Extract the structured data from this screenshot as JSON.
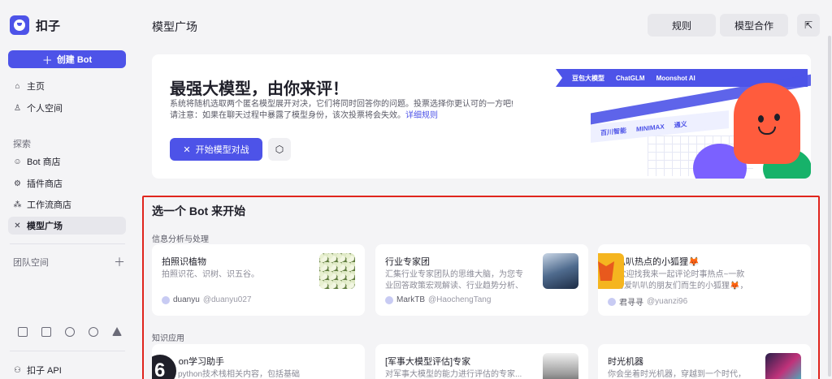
{
  "app": {
    "name": "扣子"
  },
  "sidebar": {
    "create_label": "创建 Bot",
    "nav": [
      {
        "label": "主页",
        "icon": "home-icon"
      },
      {
        "label": "个人空间",
        "icon": "user-icon"
      }
    ],
    "explore_label": "探索",
    "explore": [
      {
        "label": "Bot 商店",
        "icon": "bot-icon"
      },
      {
        "label": "插件商店",
        "icon": "plugin-icon"
      },
      {
        "label": "工作流商店",
        "icon": "workflow-icon"
      },
      {
        "label": "模型广场",
        "icon": "model-icon",
        "active": true
      }
    ],
    "team_label": "团队空间",
    "api_label": "扣子 API"
  },
  "header": {
    "title": "模型广场",
    "rules_label": "规则",
    "cooperate_label": "模型合作"
  },
  "hero": {
    "title": "最强大模型，由你来评！",
    "desc_line1": "系统将随机选取两个匿名模型展开对决，它们将同时回答你的问题。投票选择你更认可的一方吧!",
    "desc_line2": "请注意：如果在聊天过程中暴露了模型身份，该次投票将会失效。",
    "rules_link": "详细规则",
    "battle_label": "开始模型对战",
    "band_brands": [
      "豆包大模型",
      "ChatGLM",
      "Moonshot AI"
    ],
    "band2_brands": [
      "百川智能",
      "MINIMAX",
      "通义"
    ]
  },
  "bots": {
    "title": "选一个 Bot 来开始",
    "categories": [
      {
        "label": "信息分析与处理",
        "cards": [
          {
            "name": "拍照识植物",
            "desc": "拍照识花、识树、识五谷。",
            "author": "duanyu",
            "handle": "@duanyu027"
          },
          {
            "name": "行业专家团",
            "desc": "汇集行业专家团队的思维大脑，为您专业回答政策宏观解读、行业趋势分析、股票深...",
            "author": "MarkTB",
            "handle": "@HaochengTang"
          },
          {
            "name": "爱叭叭热点的小狐狸🦊",
            "desc": "🦊欢迎找我来一起评论时事热点~一款专为爱叭叭的朋友们而生的小狐狸🦊，我将与...",
            "author": "君寻寻",
            "handle": "@yuanzi96"
          }
        ]
      },
      {
        "label": "知识应用",
        "cards": [
          {
            "name": "python学习助手",
            "desc": "学习python技术栈相关内容，包括基础语法...",
            "author": "",
            "handle": ""
          },
          {
            "name": "[军事大模型评估]专家",
            "desc": "对军事大模型的能力进行评估的专家...",
            "author": "",
            "handle": ""
          },
          {
            "name": "时光机器",
            "desc": "你会坐着时光机器，穿越到一个时代，以第...",
            "author": "",
            "handle": ""
          }
        ]
      }
    ]
  },
  "colors": {
    "accent": "#4d53e8",
    "highlight_border": "#e0251d"
  }
}
